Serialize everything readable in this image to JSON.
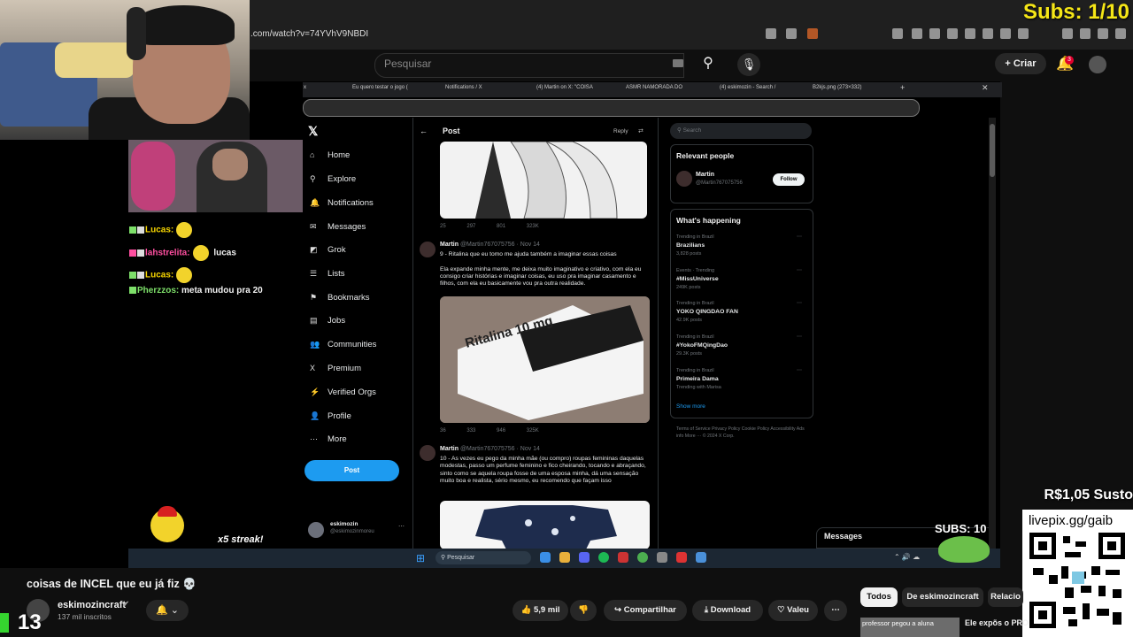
{
  "browser": {
    "url": ".com/watch?v=74YVhV9NBDI",
    "subs_top": "Subs: 1/10"
  },
  "youtube_header": {
    "search_placeholder": "Pesquisar",
    "create_label": "Criar",
    "notification_count": "3",
    "icons": [
      "search-icon",
      "mic-icon",
      "plus-icon",
      "bell-icon"
    ]
  },
  "inner_browser": {
    "tabs": [
      "x",
      "Eu quero testar o jogo (",
      "Notifications / X",
      "(4) Martin on X: \"COISA",
      "ASMR NAMORADA DO",
      "(4) eskimozin - Search /",
      "B2kjs.png (273×332)"
    ]
  },
  "x_app": {
    "nav": [
      {
        "label": "Home",
        "icon": "home-icon",
        "glyph": "⌂"
      },
      {
        "label": "Explore",
        "icon": "search-icon",
        "glyph": "⚲"
      },
      {
        "label": "Notifications",
        "icon": "bell-icon",
        "glyph": "🔔"
      },
      {
        "label": "Messages",
        "icon": "mail-icon",
        "glyph": "✉"
      },
      {
        "label": "Grok",
        "icon": "grok-icon",
        "glyph": "◩"
      },
      {
        "label": "Lists",
        "icon": "list-icon",
        "glyph": "☰"
      },
      {
        "label": "Bookmarks",
        "icon": "bookmark-icon",
        "glyph": "⚑"
      },
      {
        "label": "Jobs",
        "icon": "briefcase-icon",
        "glyph": "▤"
      },
      {
        "label": "Communities",
        "icon": "people-icon",
        "glyph": "👥"
      },
      {
        "label": "Premium",
        "icon": "x-icon",
        "glyph": "X"
      },
      {
        "label": "Verified Orgs",
        "icon": "bolt-icon",
        "glyph": "⚡"
      },
      {
        "label": "Profile",
        "icon": "user-icon",
        "glyph": "👤"
      },
      {
        "label": "More",
        "icon": "more-icon",
        "glyph": "⋯"
      }
    ],
    "post_button": "Post",
    "me": {
      "name": "eskimozin",
      "handle": "@eskimozinmoreu"
    },
    "post_header": {
      "title": "Post",
      "reply": "Reply"
    },
    "tweets": [
      {
        "name": "Martin",
        "handle": "@Martin767075756 · Nov 14",
        "text": "9 - Ritalina que eu tomo me ajuda também a imaginar essas coisas\n\nEla expande minha mente, me deixa muito imaginativo e criativo, com ela eu consigo criar histórias e imaginar coisas, eu uso pra imaginar casamento e filhos, com ela eu basicamente vou pra outra realidade.",
        "stats": [
          "36",
          "333",
          "946",
          "325K"
        ],
        "image_caption": "Ritalina 10 mg"
      },
      {
        "name": "Martin",
        "handle": "@Martin767075756 · Nov 14",
        "text": "10 - As vezes eu pego da minha mãe (ou compro) roupas femininas daquelas modestas, passo um perfume feminino e fico cheirando, tocando e abraçando, sinto como se aquela roupa fosse de uma esposa minha, dá uma sensação muito boa e realista, sério mesmo, eu recomendo que façam isso",
        "stats": [],
        "image_caption": ""
      }
    ],
    "first_stats": [
      "25",
      "297",
      "801",
      "323K"
    ],
    "right": {
      "search_placeholder": "Search",
      "relevant_title": "Relevant people",
      "relevant_name": "Martin",
      "relevant_handle": "@Martin767075756",
      "follow": "Follow",
      "happening_title": "What's happening",
      "trends": [
        {
          "context": "Trending in Brazil",
          "name": "Brazilians",
          "count": "3,828 posts"
        },
        {
          "context": "Events · Trending",
          "name": "#MissUniverse",
          "count": "249K posts"
        },
        {
          "context": "Trending in Brazil",
          "name": "YOKO QINGDAO FAN",
          "count": "42.9K posts"
        },
        {
          "context": "Trending in Brazil",
          "name": "#YokoFMQingDao",
          "count": "29.3K posts"
        },
        {
          "context": "Trending in Brazil",
          "name": "Primeira Dama",
          "count": "Trending with Marisa"
        }
      ],
      "show_more": "Show more",
      "footer": "Terms of Service  Privacy Policy  Cookie Policy  Accessibility  Ads info  More ···  © 2024 X Corp."
    },
    "messages_drawer": "Messages"
  },
  "taskbar": {
    "search": "Pesquisar"
  },
  "chat": [
    {
      "user": "Lucas:",
      "msg": "",
      "color": "yellow"
    },
    {
      "user": "lahstrelita:",
      "msg": "lucas",
      "color": "pink"
    },
    {
      "user": "Lucas:",
      "msg": "",
      "color": "yellow"
    },
    {
      "user": "Pherzzos:",
      "msg": "meta mudou pra 20",
      "color": "green"
    }
  ],
  "streak": "x5 streak!",
  "overlay": {
    "donation": "R$1,05 Susto",
    "livepix": "livepix.gg/gaib",
    "subs_bottom": "SUBS: 10",
    "counter": "13"
  },
  "video": {
    "title": "coisas de INCEL que eu já fiz 💀",
    "channel": "eskimozincraft",
    "subscribers": "137 mil inscritos",
    "likes": "5,9 mil",
    "share": "Compartilhar",
    "download": "Download",
    "thanks": "Valeu",
    "chips": [
      "Todos",
      "De eskimozincraft",
      "Relacio"
    ],
    "rec_title": "Ele expõs o PRO",
    "rec_thumb_text": "professor pegou a aluna"
  }
}
